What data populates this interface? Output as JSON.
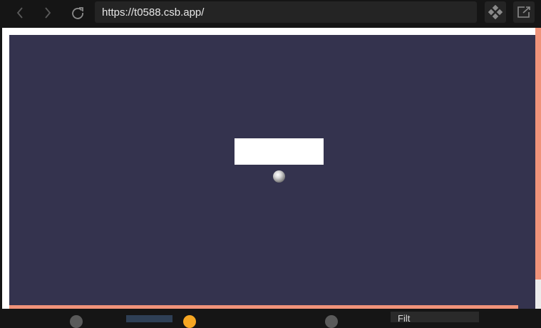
{
  "browser": {
    "url": "https://t0588.csb.app/",
    "icons": {
      "back": "chevron-left-icon",
      "forward": "chevron-right-icon",
      "reload": "reload-icon",
      "devtools": "diamond-grid-icon",
      "open_external": "external-link-icon"
    }
  },
  "preview": {
    "canvas_color": "#34334e",
    "accent_color": "#f0937a"
  },
  "bottom_bar": {
    "filter_placeholder": "Filt"
  }
}
